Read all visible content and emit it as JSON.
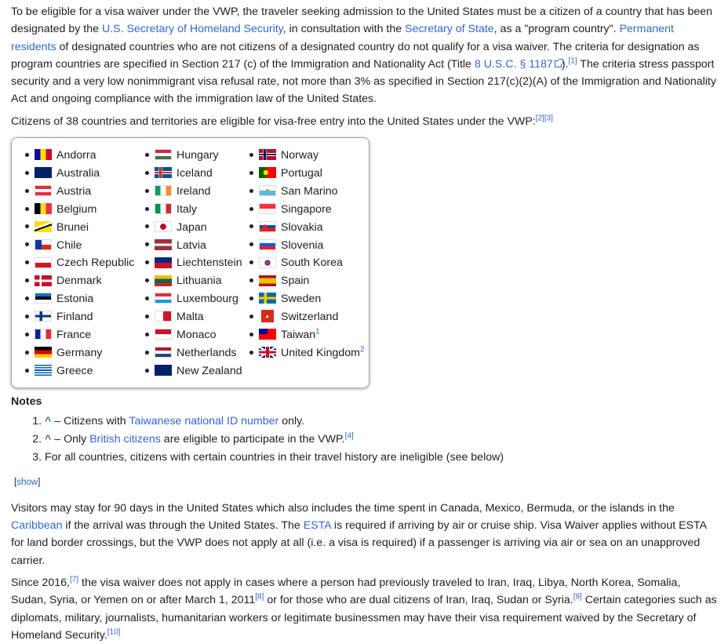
{
  "p1": {
    "t1": "To be eligible for a visa waiver under the VWP, the traveler seeking admission to the United States must be a citizen of a country that has been designated by the ",
    "l1": "U.S. Secretary of Homeland Security",
    "t2": ", in consultation with the ",
    "l2": "Secretary of State",
    "t3": ", as a \"program country\". ",
    "l3": "Permanent residents",
    "t4": " of designated countries who are not citizens of a designated country do not qualify for a visa waiver. The criteria for designation as program countries are specified in Section 217 (c) of the Immigration and Nationality Act (Title ",
    "l4": "8 U.S.C. § 1187",
    "t5": ").",
    "ref1": "[1]",
    "t6": " The criteria stress passport security and a very low nonimmigrant visa refusal rate, not more than 3% as specified in Section 217(c)(2)(A) of the Immigration and Nationality Act and ongoing compliance with the immigration law of the United States."
  },
  "p2": {
    "text": "Citizens of 38 countries and territories are eligible for visa-free entry into the United States under the VWP:",
    "ref": "[2][3]"
  },
  "countries": [
    [
      {
        "name": "Andorra",
        "flag": "andorra"
      },
      {
        "name": "Australia",
        "flag": "australia"
      },
      {
        "name": "Austria",
        "flag": "austria"
      },
      {
        "name": "Belgium",
        "flag": "belgium"
      },
      {
        "name": "Brunei",
        "flag": "brunei"
      },
      {
        "name": "Chile",
        "flag": "chile"
      },
      {
        "name": "Czech Republic",
        "flag": "czech"
      },
      {
        "name": "Denmark",
        "flag": "denmark"
      },
      {
        "name": "Estonia",
        "flag": "estonia"
      },
      {
        "name": "Finland",
        "flag": "finland"
      },
      {
        "name": "France",
        "flag": "france"
      },
      {
        "name": "Germany",
        "flag": "germany"
      },
      {
        "name": "Greece",
        "flag": "greece"
      }
    ],
    [
      {
        "name": "Hungary",
        "flag": "hungary"
      },
      {
        "name": "Iceland",
        "flag": "iceland"
      },
      {
        "name": "Ireland",
        "flag": "ireland"
      },
      {
        "name": "Italy",
        "flag": "italy"
      },
      {
        "name": "Japan",
        "flag": "japan"
      },
      {
        "name": "Latvia",
        "flag": "latvia"
      },
      {
        "name": "Liechtenstein",
        "flag": "liechtenstein"
      },
      {
        "name": "Lithuania",
        "flag": "lithuania"
      },
      {
        "name": "Luxembourg",
        "flag": "luxembourg"
      },
      {
        "name": "Malta",
        "flag": "malta"
      },
      {
        "name": "Monaco",
        "flag": "monaco"
      },
      {
        "name": "Netherlands",
        "flag": "netherlands"
      },
      {
        "name": "New Zealand",
        "flag": "newzealand"
      }
    ],
    [
      {
        "name": "Norway",
        "flag": "norway"
      },
      {
        "name": "Portugal",
        "flag": "portugal"
      },
      {
        "name": "San Marino",
        "flag": "sanmarino"
      },
      {
        "name": "Singapore",
        "flag": "singapore"
      },
      {
        "name": "Slovakia",
        "flag": "slovakia"
      },
      {
        "name": "Slovenia",
        "flag": "slovenia"
      },
      {
        "name": "South Korea",
        "flag": "southkorea"
      },
      {
        "name": "Spain",
        "flag": "spain"
      },
      {
        "name": "Sweden",
        "flag": "sweden"
      },
      {
        "name": "Switzerland",
        "flag": "switzerland"
      },
      {
        "name": "Taiwan",
        "flag": "taiwan",
        "sup": "1"
      },
      {
        "name": "United Kingdom",
        "flag": "uk",
        "sup": "2"
      }
    ]
  ],
  "notes": {
    "title": "Notes",
    "n1": {
      "caret": "^",
      "t1": " – Citizens with ",
      "link": "Taiwanese national ID number",
      "t2": " only."
    },
    "n2": {
      "caret": "^",
      "t1": " – Only ",
      "link": "British citizens",
      "t2": " are eligible to participate in the VWP.",
      "ref": "[4]"
    },
    "n3": {
      "text": "For all countries, citizens with certain countries in their travel history are ineligible (see below)"
    }
  },
  "show": {
    "lb": "[",
    "link": "show",
    "rb": "]"
  },
  "p3": {
    "t1": "Visitors may stay for 90 days in the United States which also includes the time spent in Canada, Mexico, Bermuda, or the islands in the ",
    "l1": "Caribbean",
    "t2": " if the arrival was through the United States. The ",
    "l2": "ESTA",
    "t3": " is required if arriving by air or cruise ship. Visa Waiver applies without ESTA for land border crossings, but the VWP does not apply at all (i.e. a visa is required) if a passenger is arriving via air or sea on an unapproved carrier."
  },
  "p4": {
    "t1": "Since 2016,",
    "r1": "[7]",
    "t2": " the visa waiver does not apply in cases where a person had previously traveled to Iran, Iraq, Libya, North Korea, Somalia, Sudan, Syria, or Yemen on or after March 1, 2011",
    "r2": "[8]",
    "t3": " or for those who are dual citizens of Iran, Iraq, Sudan or Syria.",
    "r3": "[9]",
    "t4": " Certain categories such as diplomats, military, journalists, humanitarian workers or legitimate businessmen may have their visa requirement waived by the Secretary of Homeland Security.",
    "r4": "[10]"
  }
}
